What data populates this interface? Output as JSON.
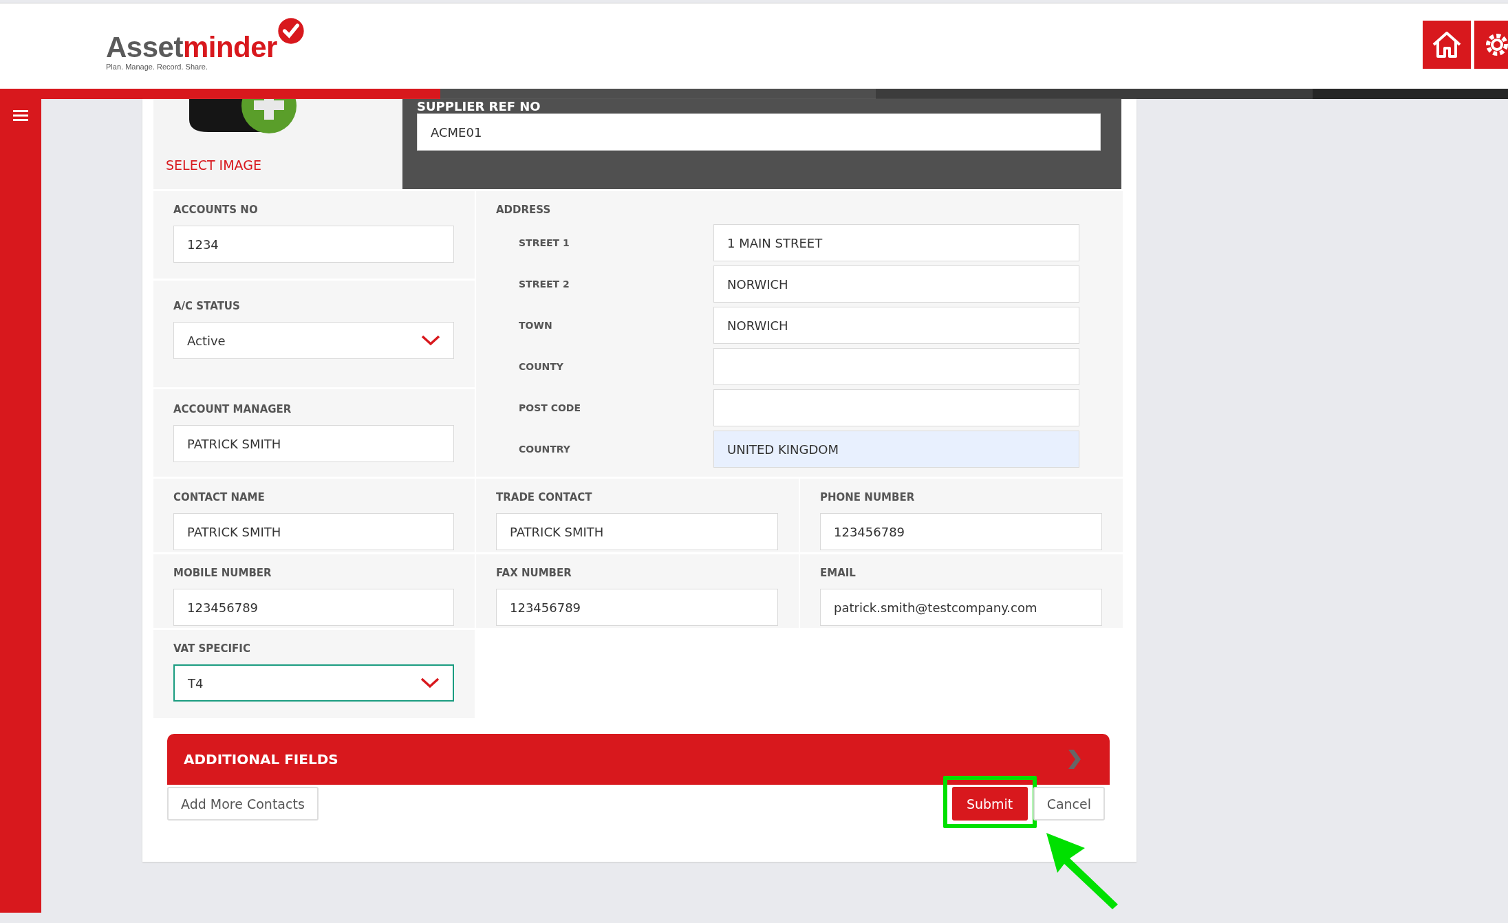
{
  "header": {
    "logo": {
      "name_dark": "Asset",
      "name_red": "minder",
      "tagline": "Plan. Manage. Record. Share."
    }
  },
  "image_panel": {
    "link": "SELECT IMAGE"
  },
  "supplier_ref": {
    "label": "SUPPLIER REF NO",
    "value": "ACME01"
  },
  "left_fields": [
    {
      "label": "ACCOUNTS NO",
      "kind": "text",
      "value": "1234"
    },
    {
      "label": "A/C STATUS",
      "kind": "select",
      "value": "Active"
    },
    {
      "label": "ACCOUNT MANAGER",
      "kind": "text",
      "value": "PATRICK SMITH"
    }
  ],
  "address": {
    "label": "ADDRESS",
    "lines": [
      {
        "label": "STREET 1",
        "value": "1 MAIN STREET",
        "autofilled": false
      },
      {
        "label": "STREET 2",
        "value": "NORWICH",
        "autofilled": false
      },
      {
        "label": "TOWN",
        "value": "NORWICH",
        "autofilled": false
      },
      {
        "label": "COUNTY",
        "autofilled": false
      },
      {
        "label": "POST CODE",
        "autofilled": false
      },
      {
        "label": "COUNTRY",
        "value": "UNITED KINGDOM",
        "autofilled": true
      }
    ]
  },
  "contact_rows": [
    [
      {
        "label": "CONTACT NAME",
        "value": "PATRICK SMITH"
      },
      {
        "label": "TRADE CONTACT",
        "value": "PATRICK SMITH"
      },
      {
        "label": "PHONE NUMBER",
        "value": "123456789"
      }
    ],
    [
      {
        "label": "MOBILE NUMBER",
        "value": "123456789"
      },
      {
        "label": "FAX NUMBER",
        "value": "123456789"
      },
      {
        "label": "EMAIL",
        "value": "patrick.smith@testcompany.com"
      }
    ]
  ],
  "vat": {
    "label": "VAT SPECIFIC",
    "value": "T4",
    "focused": true
  },
  "additional_fields": {
    "title": "ADDITIONAL FIELDS"
  },
  "buttons": [
    {
      "label": "Add More Contacts",
      "kind": "default",
      "highlighted": false
    },
    {
      "label": "Submit",
      "kind": "primary",
      "highlighted": true
    },
    {
      "label": "Cancel",
      "kind": "default",
      "highlighted": false
    }
  ]
}
